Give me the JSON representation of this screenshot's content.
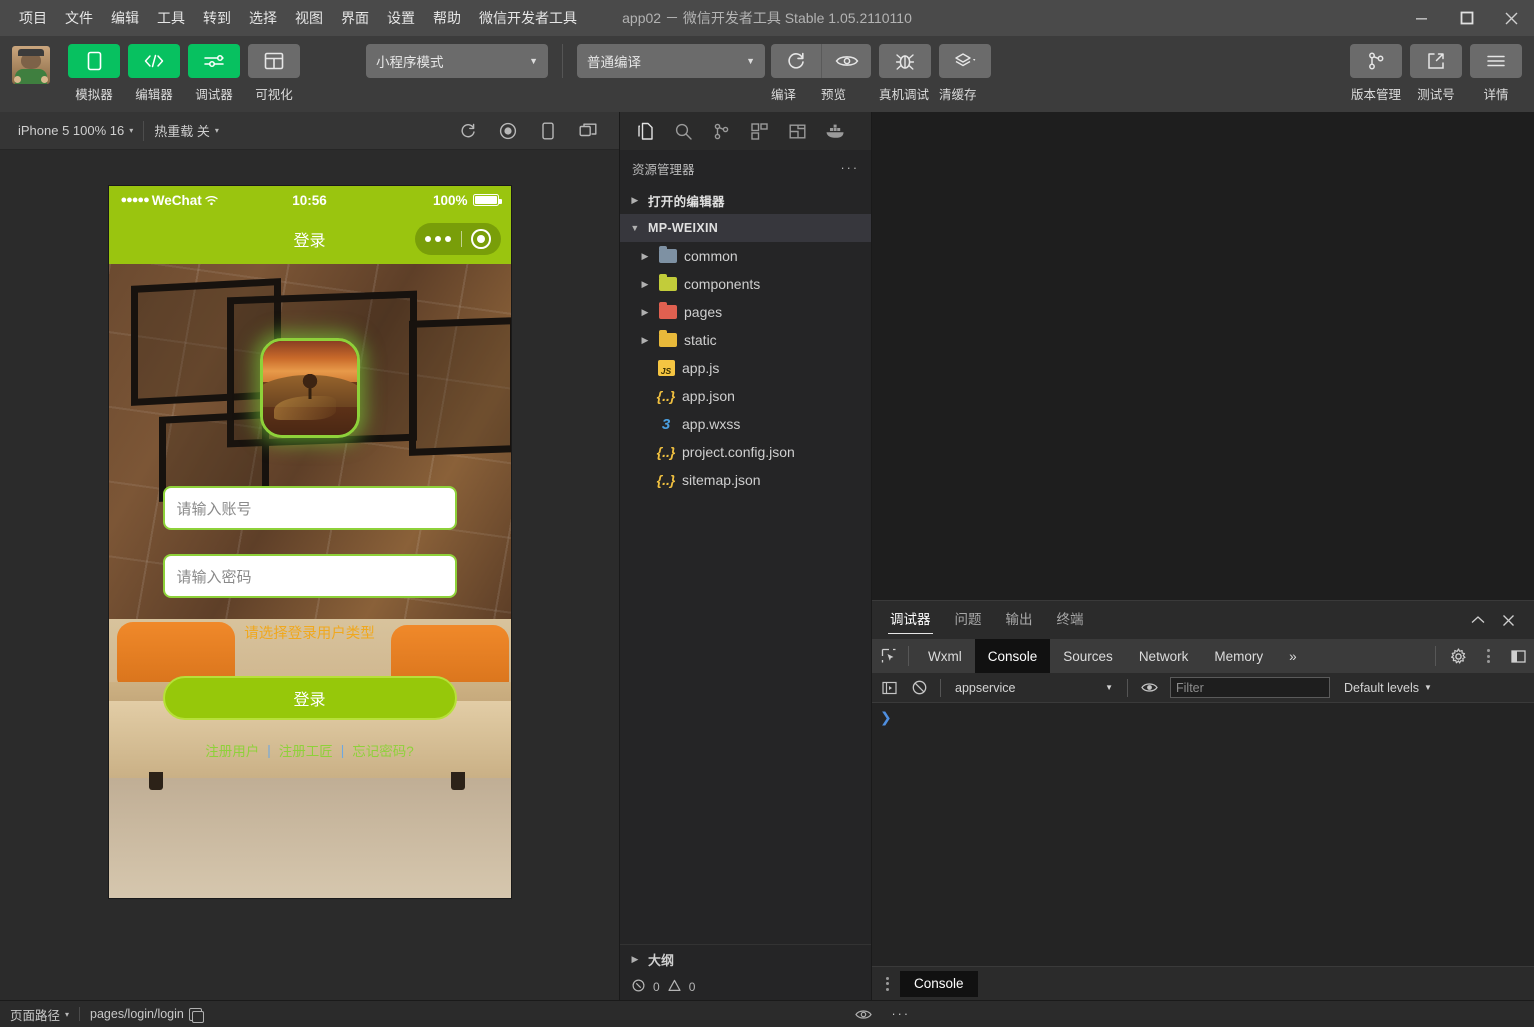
{
  "titlebar": {
    "menus": [
      "项目",
      "文件",
      "编辑",
      "工具",
      "转到",
      "选择",
      "视图",
      "界面",
      "设置",
      "帮助",
      "微信开发者工具"
    ],
    "window_title": "app02 － 微信开发者工具 Stable 1.05.2110110",
    "controls": {
      "minimize": "minimize-icon",
      "maximize": "maximize-icon",
      "close": "close-icon"
    }
  },
  "toolbar": {
    "avatar": "user-avatar",
    "left_buttons": [
      {
        "label": "模拟器",
        "icon": "phone-icon",
        "state": "green"
      },
      {
        "label": "编辑器",
        "icon": "code-icon",
        "state": "green"
      },
      {
        "label": "调试器",
        "icon": "sliders-icon",
        "state": "green"
      },
      {
        "label": "可视化",
        "icon": "layout-icon",
        "state": "grey"
      }
    ],
    "mode_select": {
      "value": "小程序模式",
      "caret": "▼"
    },
    "compile_select": {
      "value": "普通编译",
      "caret": "▼"
    },
    "actions": [
      {
        "label": "编译",
        "icon": "refresh-icon"
      },
      {
        "label": "预览",
        "icon": "eye-icon"
      },
      {
        "label": "真机调试",
        "icon": "bug-icon"
      },
      {
        "label": "清缓存",
        "icon": "layers-icon"
      }
    ],
    "right_buttons": [
      {
        "label": "版本管理",
        "icon": "git-branch-icon"
      },
      {
        "label": "测试号",
        "icon": "external-link-icon"
      },
      {
        "label": "详情",
        "icon": "hamburger-icon"
      }
    ]
  },
  "simulator": {
    "device_select": {
      "value": "iPhone 5 100% 16",
      "caret": "▾"
    },
    "hot_reload": {
      "value": "热重载 关",
      "caret": "▾"
    },
    "icons": [
      "refresh-icon",
      "record-icon",
      "rotate-device-icon",
      "multi-window-icon"
    ],
    "phone": {
      "status_bar": {
        "carrier": "WeChat",
        "signal_dots": "●●●●●",
        "wifi": "wifi-icon",
        "time": "10:56",
        "battery_percent": "100%"
      },
      "nav_title": "登录",
      "capsule": {
        "more": "more-dots-icon",
        "target": "target-icon"
      },
      "logo": "app-logo-landscape",
      "account_placeholder": "请输入账号",
      "password_placeholder": "请输入密码",
      "type_hint": "请选择登录用户类型",
      "login_button": "登录",
      "links": [
        "注册用户",
        "注册工匠",
        "忘记密码?"
      ],
      "link_separator": "|"
    }
  },
  "explorer": {
    "activity_icons": [
      "files-icon",
      "search-icon",
      "source-control-icon",
      "extensions-icon",
      "layout-panel-icon",
      "docker-icon"
    ],
    "header": {
      "title": "资源管理器",
      "more": "···"
    },
    "sections": [
      {
        "label": "打开的编辑器",
        "expanded": false,
        "arrow": "▶"
      },
      {
        "label": "MP-WEIXIN",
        "expanded": true,
        "arrow": "▼"
      }
    ],
    "folders": [
      {
        "name": "common",
        "icon": "folder-grey",
        "color": "#7e91a3",
        "arrow": "▶"
      },
      {
        "name": "components",
        "icon": "folder-green",
        "color": "#c2cc3a",
        "arrow": "▶"
      },
      {
        "name": "pages",
        "icon": "folder-red",
        "color": "#e06050",
        "arrow": "▶"
      },
      {
        "name": "static",
        "icon": "folder-yellow",
        "color": "#e8b93a",
        "arrow": "▶"
      }
    ],
    "files": [
      {
        "name": "app.js",
        "type": "js",
        "badge": "JS"
      },
      {
        "name": "app.json",
        "type": "json",
        "badge": "{..}"
      },
      {
        "name": "app.wxss",
        "type": "wxss",
        "badge": "3"
      },
      {
        "name": "project.config.json",
        "type": "json",
        "badge": "{..}"
      },
      {
        "name": "sitemap.json",
        "type": "json",
        "badge": "{..}"
      }
    ],
    "outline": {
      "label": "大纲",
      "arrow": "▶"
    },
    "problems": {
      "errors": "0",
      "warnings": "0",
      "error_icon": "error-circle-icon",
      "warning_icon": "warning-triangle-icon"
    }
  },
  "devtools": {
    "panel_tabs": [
      {
        "label": "调试器",
        "active": true
      },
      {
        "label": "问题",
        "active": false
      },
      {
        "label": "输出",
        "active": false
      },
      {
        "label": "终端",
        "active": false
      }
    ],
    "panel_controls": {
      "collapse": "chevron-up-icon",
      "close": "close-icon"
    },
    "sub_tabs": [
      {
        "label": "Wxml",
        "active": false
      },
      {
        "label": "Console",
        "active": true
      },
      {
        "label": "Sources",
        "active": false
      },
      {
        "label": "Network",
        "active": false
      },
      {
        "label": "Memory",
        "active": false
      }
    ],
    "inspect_icon": "inspect-element-icon",
    "overflow": "»",
    "tail_icons": [
      "gear-icon",
      "kebab-menu-icon",
      "dock-icon"
    ],
    "console_bar": {
      "sidebar_icon": "console-sidebar-icon",
      "clear_icon": "clear-console-icon",
      "context": "appservice",
      "context_caret": "▼",
      "eye_icon": "live-expression-icon",
      "filter_placeholder": "Filter",
      "levels": "Default levels",
      "levels_caret": "▼"
    },
    "prompt": "❯",
    "footer_tab": "Console",
    "footer_kebab": "kebab-menu-icon"
  },
  "statusbar": {
    "page_path_label": "页面路径",
    "page_path_caret": "▾",
    "page_path_value": "pages/login/login",
    "copy_icon": "copy-icon",
    "eye_icon": "eye-icon",
    "more_icon": "···"
  }
}
